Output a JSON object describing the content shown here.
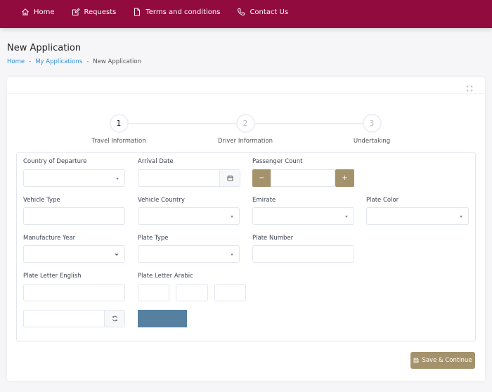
{
  "nav": {
    "items": [
      {
        "label": "Home",
        "icon": "home-icon"
      },
      {
        "label": "Requests",
        "icon": "edit-icon"
      },
      {
        "label": "Terms and conditions",
        "icon": "file-icon"
      },
      {
        "label": "Contact Us",
        "icon": "phone-icon"
      }
    ]
  },
  "page": {
    "title": "New Application",
    "breadcrumb": [
      "Home",
      "My Applications",
      "New Application"
    ],
    "breadcrumb_sep": "-"
  },
  "stepper": {
    "steps": [
      {
        "number": "1",
        "label": "Travel Information",
        "active": true
      },
      {
        "number": "2",
        "label": "Driver Information",
        "active": false
      },
      {
        "number": "3",
        "label": "Undertaking",
        "active": false
      }
    ]
  },
  "form": {
    "country_of_departure": {
      "label": "Country of Departure",
      "value": ""
    },
    "arrival_date": {
      "label": "Arrival Date",
      "value": ""
    },
    "passenger_count": {
      "label": "Passenger Count",
      "value": "",
      "minus": "−",
      "plus": "+"
    },
    "vehicle_type": {
      "label": "Vehicle Type",
      "value": ""
    },
    "vehicle_country": {
      "label": "Vehicle Country",
      "value": ""
    },
    "emirate": {
      "label": "Emirate",
      "value": ""
    },
    "plate_color": {
      "label": "Plate Color",
      "value": ""
    },
    "manufacture_year": {
      "label": "Manufacture Year",
      "value": ""
    },
    "plate_type": {
      "label": "Plate Type",
      "value": ""
    },
    "plate_number": {
      "label": "Plate Number",
      "value": ""
    },
    "plate_letter_english": {
      "label": "Plate Letter English",
      "value": ""
    },
    "plate_letter_arabic": {
      "label": "Plate Letter Arabic",
      "values": [
        "",
        "",
        ""
      ]
    },
    "captcha": {
      "value": "",
      "image_color": "#5580a0"
    }
  },
  "actions": {
    "save_continue": "Save & Continue"
  },
  "colors": {
    "brand": "#910b3e",
    "accent": "#a4926c",
    "link": "#2f8fd8"
  }
}
